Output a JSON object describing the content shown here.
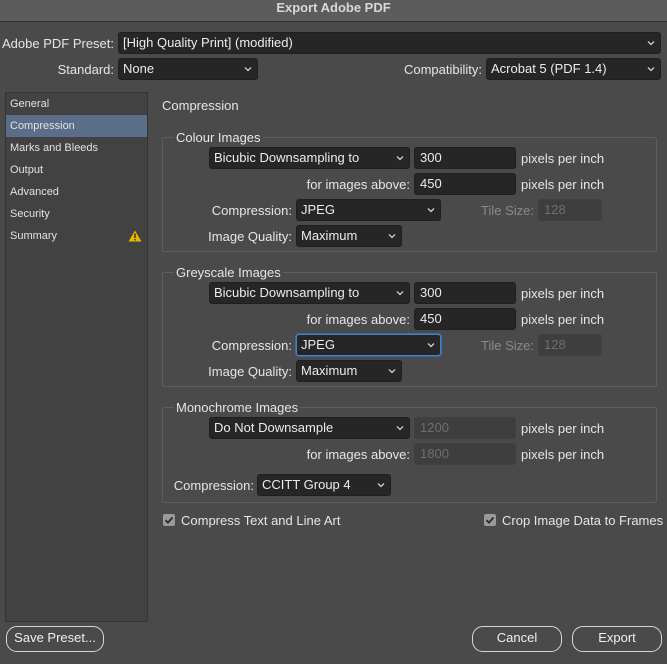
{
  "window": {
    "title": "Export Adobe PDF"
  },
  "preset": {
    "label": "Adobe PDF Preset:",
    "value": "[High Quality Print] (modified)"
  },
  "standard": {
    "label": "Standard:",
    "value": "None"
  },
  "compatibility": {
    "label": "Compatibility:",
    "value": "Acrobat 5 (PDF 1.4)"
  },
  "sidebar": {
    "items": [
      {
        "label": "General"
      },
      {
        "label": "Compression"
      },
      {
        "label": "Marks and Bleeds"
      },
      {
        "label": "Output"
      },
      {
        "label": "Advanced"
      },
      {
        "label": "Security"
      },
      {
        "label": "Summary"
      }
    ]
  },
  "section_title": "Compression",
  "colour": {
    "title": "Colour Images",
    "downsampling": "Bicubic Downsampling to",
    "ppi_value": "300",
    "ppi_unit": "pixels per inch",
    "above_label": "for images above:",
    "above_value": "450",
    "above_unit": "pixels per inch",
    "compression_label": "Compression:",
    "compression_value": "JPEG",
    "tile_label": "Tile Size:",
    "tile_value": "128",
    "quality_label": "Image Quality:",
    "quality_value": "Maximum"
  },
  "greyscale": {
    "title": "Greyscale Images",
    "downsampling": "Bicubic Downsampling to",
    "ppi_value": "300",
    "ppi_unit": "pixels per inch",
    "above_label": "for images above:",
    "above_value": "450",
    "above_unit": "pixels per inch",
    "compression_label": "Compression:",
    "compression_value": "JPEG",
    "tile_label": "Tile Size:",
    "tile_value": "128",
    "quality_label": "Image Quality:",
    "quality_value": "Maximum"
  },
  "monochrome": {
    "title": "Monochrome Images",
    "downsampling": "Do Not Downsample",
    "ppi_value": "1200",
    "ppi_unit": "pixels per inch",
    "above_label": "for images above:",
    "above_value": "1800",
    "above_unit": "pixels per inch",
    "compression_label": "Compression:",
    "compression_value": "CCITT Group 4"
  },
  "options": {
    "compress_text": "Compress Text and Line Art",
    "crop_image": "Crop Image Data to Frames"
  },
  "buttons": {
    "save_preset": "Save Preset...",
    "cancel": "Cancel",
    "export": "Export"
  },
  "colors": {
    "accent": "#5a6e89",
    "warning": "#e8b800",
    "focus": "#4a7fbf"
  }
}
